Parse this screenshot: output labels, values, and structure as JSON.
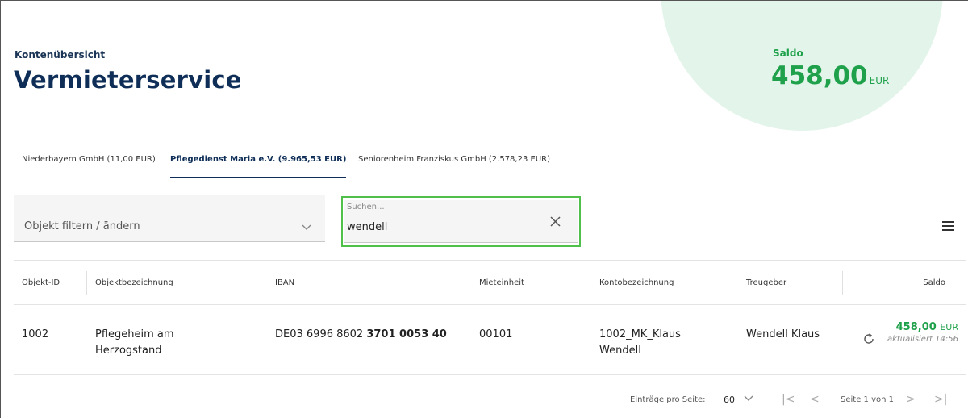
{
  "header": {
    "eyebrow": "Kontenübersicht",
    "title": "Vermieterservice",
    "saldo_label": "Saldo",
    "saldo_value": "458,00",
    "saldo_currency": "EUR",
    "accent_color": "#1fa14b",
    "brand_color": "#0e2e57"
  },
  "tabs": [
    {
      "label": "Niederbayern GmbH (11,00 EUR)",
      "active": false
    },
    {
      "label": "Pflegedienst Maria e.V. (9.965,53 EUR)",
      "active": true
    },
    {
      "label": "Seniorenheim Franziskus GmbH (2.578,23 EUR)",
      "active": false
    }
  ],
  "filter": {
    "placeholder": "Objekt filtern / ändern",
    "chevron_icon": "chevron-down-icon"
  },
  "search": {
    "label": "Suchen...",
    "value": "wendell",
    "clear_icon": "close-icon"
  },
  "menu_icon": "hamburger-icon",
  "table": {
    "columns": [
      "Objekt-ID",
      "Objektbezeichnung",
      "IBAN",
      "Mieteinheit",
      "Kontobezeichnung",
      "Treugeber",
      "Saldo"
    ],
    "rows": [
      {
        "objekt_id": "1002",
        "objektbezeichnung_1": "Pflegeheim am",
        "objektbezeichnung_2": "Herzogstand",
        "iban_prefix": "DE03 6996 8602 ",
        "iban_bold": "3701 0053 40",
        "mieteinheit": "00101",
        "kontobezeichnung_1": "1002_MK_Klaus",
        "kontobezeichnung_2": "Wendell",
        "treugeber": "Wendell Klaus",
        "saldo_value": "458,00",
        "saldo_currency": "EUR",
        "updated": "aktualisiert 14:56",
        "refresh_icon": "refresh-icon"
      }
    ]
  },
  "pager": {
    "label": "Einträge pro Seite:",
    "page_size": "60",
    "info": "Seite 1 von 1",
    "first_symbol": "|<",
    "prev_symbol": "<",
    "next_symbol": ">",
    "last_symbol": ">|"
  }
}
